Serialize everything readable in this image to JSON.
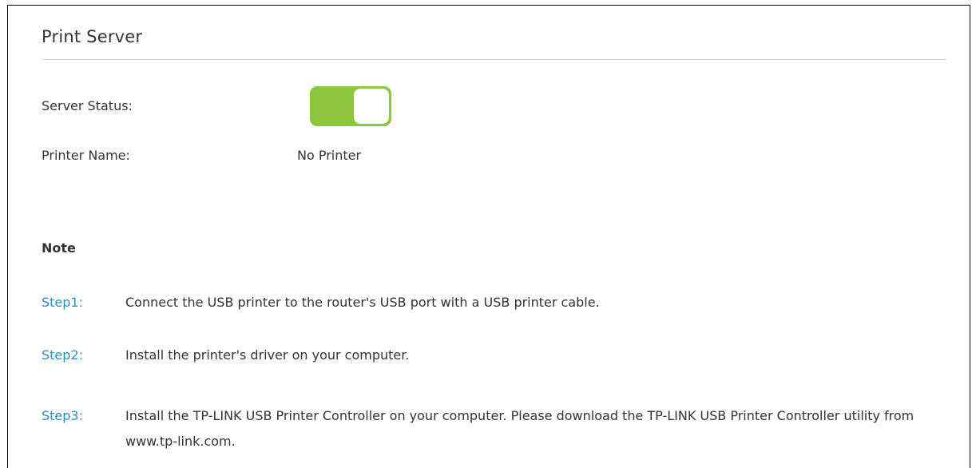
{
  "panel": {
    "title": "Print Server"
  },
  "server_status": {
    "label": "Server Status:",
    "toggle_on": true,
    "on_color": "#8dc63f"
  },
  "printer_name": {
    "label": "Printer Name:",
    "value": "No Printer"
  },
  "note": {
    "heading": "Note",
    "steps": [
      {
        "label": "Step1:",
        "text": "Connect the USB printer to the router's USB port with a USB printer cable."
      },
      {
        "label": "Step2:",
        "text": "Install the printer's driver on your computer."
      },
      {
        "label": "Step3:",
        "text": "Install the TP-LINK USB Printer Controller on your computer. Please download the TP-LINK USB Printer Controller utility from www.tp-link.com."
      }
    ],
    "step_label_color": "#2b8fb8"
  }
}
